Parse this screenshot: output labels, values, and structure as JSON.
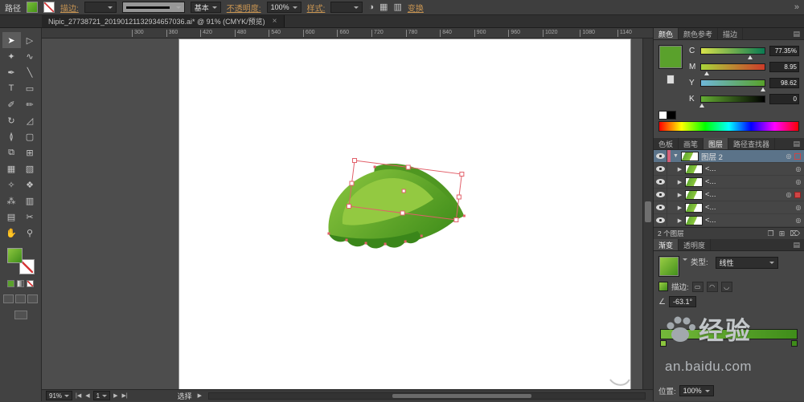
{
  "colors": {
    "accent_green": "#5aa12c",
    "selection_red": "#e2606a",
    "layer_highlight": "#5b7389"
  },
  "control_bar": {
    "selection_type": "路径",
    "stroke_link": "描边:",
    "brush_value": "基本",
    "opacity_label": "不透明度:",
    "opacity_value": "100%",
    "style_label": "样式:",
    "transform_link": "变换"
  },
  "document_tab": {
    "title": "Nipic_27738721_20190121132934657036.ai* @ 91% (CMYK/预览)",
    "close": "×"
  },
  "ruler": {
    "ticks": [
      "300",
      "360",
      "420",
      "480",
      "540",
      "600",
      "660",
      "720",
      "780",
      "840",
      "900",
      "960",
      "1020",
      "1080",
      "1140"
    ]
  },
  "toolbar": {
    "tools": [
      {
        "name": "selection-tool",
        "glyph": "➤"
      },
      {
        "name": "direct-selection-tool",
        "glyph": "▷"
      },
      {
        "name": "magic-wand-tool",
        "glyph": "✦"
      },
      {
        "name": "lasso-tool",
        "glyph": "∿"
      },
      {
        "name": "pen-tool",
        "glyph": "✒"
      },
      {
        "name": "line-segment-tool",
        "glyph": "╲"
      },
      {
        "name": "type-tool",
        "glyph": "T"
      },
      {
        "name": "rectangle-tool",
        "glyph": "▭"
      },
      {
        "name": "paintbrush-tool",
        "glyph": "✐"
      },
      {
        "name": "pencil-tool",
        "glyph": "✏"
      },
      {
        "name": "rotate-tool",
        "glyph": "↻"
      },
      {
        "name": "scale-tool",
        "glyph": "◿"
      },
      {
        "name": "width-tool",
        "glyph": "≬"
      },
      {
        "name": "free-transform-tool",
        "glyph": "▢"
      },
      {
        "name": "shape-builder-tool",
        "glyph": "⧉"
      },
      {
        "name": "perspective-grid-tool",
        "glyph": "⊞"
      },
      {
        "name": "mesh-tool",
        "glyph": "▦"
      },
      {
        "name": "gradient-tool",
        "glyph": "▧"
      },
      {
        "name": "eyedropper-tool",
        "glyph": "✧"
      },
      {
        "name": "blend-tool",
        "glyph": "❖"
      },
      {
        "name": "symbol-sprayer-tool",
        "glyph": "⁂"
      },
      {
        "name": "column-graph-tool",
        "glyph": "▥"
      },
      {
        "name": "artboard-tool",
        "glyph": "▤"
      },
      {
        "name": "slice-tool",
        "glyph": "✂"
      },
      {
        "name": "hand-tool",
        "glyph": "✋"
      },
      {
        "name": "zoom-tool",
        "glyph": "⚲"
      }
    ]
  },
  "color_panel": {
    "tabs": [
      "颜色",
      "颜色参考",
      "描边"
    ],
    "channels": [
      {
        "label": "C",
        "value": "77.35%"
      },
      {
        "label": "M",
        "value": "8.95"
      },
      {
        "label": "Y",
        "value": "98.62"
      },
      {
        "label": "K",
        "value": "0"
      }
    ]
  },
  "layers_panel": {
    "tabs": [
      "色板",
      "画笔",
      "图层",
      "路径查找器"
    ],
    "rows": [
      {
        "label": "图层 2"
      },
      {
        "label": "<..."
      },
      {
        "label": "<..."
      },
      {
        "label": "<..."
      },
      {
        "label": "<..."
      },
      {
        "label": "<..."
      }
    ],
    "footer": "2 个图层"
  },
  "gradient_panel": {
    "tabs": [
      "渐变",
      "透明度"
    ],
    "type_label": "类型:",
    "type_value": "线性",
    "stroke_label": "描边:",
    "angle_value": "-63.1°",
    "position_label": "位置:",
    "position_value": "100%"
  },
  "status_bar": {
    "zoom_value": "91%",
    "artboard_value": "1",
    "tool_status": "选择"
  },
  "watermark": {
    "title": "经验",
    "domain": "an.baidu.com"
  },
  "icons": {
    "panel_menu": "▤",
    "target": "◎",
    "expand_open": "▼",
    "expand_closed": "▶",
    "new_sublayer": "❐",
    "new_layer": "⊞",
    "delete_layer": "⌦",
    "doc_setup": "◑",
    "grid_a": "▦",
    "grid_b": "▥",
    "collapse": "»",
    "nav_first": "|◀",
    "nav_prev": "◀",
    "nav_next": "▶",
    "nav_last": "▶|",
    "status_expand": "▶",
    "stroke_within": "▭",
    "stroke_along": "◠",
    "stroke_across": "◡"
  }
}
